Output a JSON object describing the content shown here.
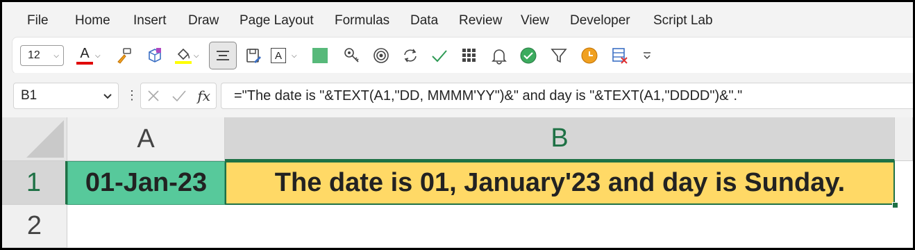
{
  "menu": {
    "items": [
      "File",
      "Home",
      "Insert",
      "Draw",
      "Page Layout",
      "Formulas",
      "Data",
      "Review",
      "View",
      "Developer",
      "Script Lab"
    ]
  },
  "toolbar": {
    "font_size": "12",
    "font_color_letter": "A",
    "text_box_letter": "A",
    "icons": [
      "font-color-icon",
      "format-painter-icon",
      "3d-box-icon",
      "fill-color-icon",
      "align-center-icon",
      "save-form-icon",
      "text-box-icon",
      "green-square-icon",
      "key-icon",
      "target-icon",
      "refresh-icon",
      "checkmark-icon",
      "grid-icon",
      "bell-icon",
      "green-check-circle-icon",
      "filter-icon",
      "clock-icon",
      "remove-table-icon",
      "more-icon"
    ],
    "colors": {
      "font_color_bar": "#e00000",
      "fill_color_bar": "#ffff00",
      "green_square": "#57b97a",
      "clock": "#f0a020"
    }
  },
  "formula_bar": {
    "name_box": "B1",
    "fx_label": "fx",
    "formula": "=\"The date is \"&TEXT(A1,\"DD, MMMM'YY\")&\" and day is \"&TEXT(A1,\"DDDD\")&\".\""
  },
  "grid": {
    "columns": [
      "A",
      "B"
    ],
    "rows": [
      "1",
      "2"
    ],
    "cells": {
      "A1": "01-Jan-23",
      "B1": "The date is 01, January'23 and day is Sunday."
    },
    "colors": {
      "A1_fill": "#57c99b",
      "B1_fill": "#ffd966",
      "selection": "#1e7145"
    }
  }
}
